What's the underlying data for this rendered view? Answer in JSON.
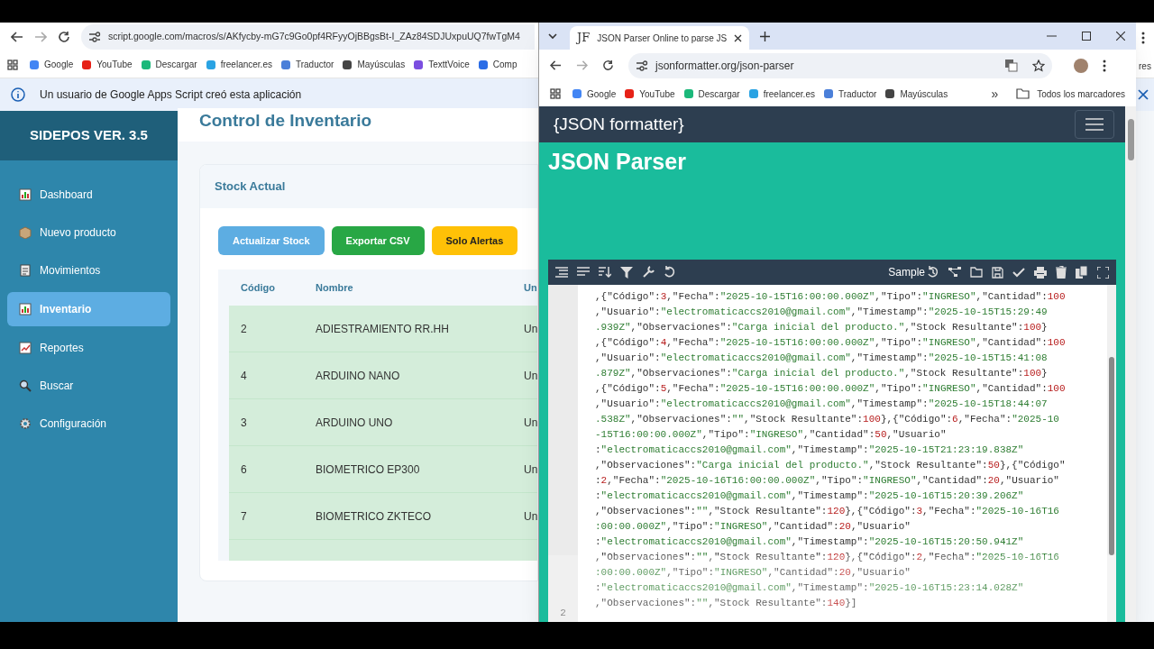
{
  "left_browser": {
    "url": "script.google.com/macros/s/AKfycby-mG7c9Go0pf4RFyyOjBBgsBt-I_ZAz84SDJUxpuUQ7fwTgM4",
    "bookmarks": [
      "Google",
      "YouTube",
      "Descargar",
      "freelancer.es",
      "Traductor",
      "Mayúsculas",
      "TexttVoice",
      "Comp"
    ],
    "bookmarks_tail": "res",
    "info_bar": "Un usuario de Google Apps Script creó esta aplicación"
  },
  "app": {
    "brand": "SIDEPOS VER. 3.5",
    "sidebar": [
      {
        "label": "Dashboard",
        "selected": false
      },
      {
        "label": "Nuevo producto",
        "selected": false
      },
      {
        "label": "Movimientos",
        "selected": false
      },
      {
        "label": "Inventario",
        "selected": true
      },
      {
        "label": "Reportes",
        "selected": false
      },
      {
        "label": "Buscar",
        "selected": false
      },
      {
        "label": "Configuración",
        "selected": false
      }
    ],
    "page_title": "Control de Inventario",
    "card_title": "Stock Actual",
    "buttons": [
      {
        "label": "Actualizar Stock",
        "kind": "info"
      },
      {
        "label": "Exportar CSV",
        "kind": "success"
      },
      {
        "label": "Solo Alertas",
        "kind": "warning"
      }
    ],
    "table": {
      "columns": [
        "Código",
        "Nombre",
        "Un"
      ],
      "rows": [
        [
          "2",
          "ADIESTRAMIENTO RR.HH",
          "Un"
        ],
        [
          "4",
          "ARDUINO NANO",
          "Un"
        ],
        [
          "3",
          "ARDUINO UNO",
          "Un"
        ],
        [
          "6",
          "BIOMETRICO EP300",
          "Un"
        ],
        [
          "7",
          "BIOMETRICO ZKTECO",
          "Un"
        ]
      ]
    }
  },
  "right_browser": {
    "tab_favicon": "JF",
    "tab_title": "JSON Parser Online to parse JS",
    "url": "jsonformatter.org/json-parser",
    "bookmarks": [
      "Google",
      "YouTube",
      "Descargar",
      "freelancer.es",
      "Traductor",
      "Mayúsculas"
    ],
    "more": "»",
    "all_bookmarks": "Todos los marcadores",
    "site_logo": "{JSON formatter}",
    "heading": "JSON Parser",
    "sample_label": "Sample",
    "editor_lines": [
      ",{\"Código\":3,\"Fecha\":\"2025-10-15T16:00:00.000Z\",\"Tipo\":\"INGRESO\",\"Cantidad\":100",
      ",\"Usuario\":\"electromaticaccs2010@gmail.com\",\"Timestamp\":\"2025-10-15T15:29:49",
      ".939Z\",\"Observaciones\":\"Carga inicial del producto.\",\"Stock Resultante\":100}",
      ",{\"Código\":4,\"Fecha\":\"2025-10-15T16:00:00.000Z\",\"Tipo\":\"INGRESO\",\"Cantidad\":100",
      ",\"Usuario\":\"electromaticaccs2010@gmail.com\",\"Timestamp\":\"2025-10-15T15:41:08",
      ".879Z\",\"Observaciones\":\"Carga inicial del producto.\",\"Stock Resultante\":100}",
      ",{\"Código\":5,\"Fecha\":\"2025-10-15T16:00:00.000Z\",\"Tipo\":\"INGRESO\",\"Cantidad\":100",
      ",\"Usuario\":\"electromaticaccs2010@gmail.com\",\"Timestamp\":\"2025-10-15T18:44:07",
      ".538Z\",\"Observaciones\":\"\",\"Stock Resultante\":100},{\"Código\":6,\"Fecha\":\"2025-10",
      "-15T16:00:00.000Z\",\"Tipo\":\"INGRESO\",\"Cantidad\":50,\"Usuario\"",
      ":\"electromaticaccs2010@gmail.com\",\"Timestamp\":\"2025-10-15T21:23:19.838Z\"",
      ",\"Observaciones\":\"Carga inicial del producto.\",\"Stock Resultante\":50},{\"Código\"",
      ":2,\"Fecha\":\"2025-10-16T16:00:00.000Z\",\"Tipo\":\"INGRESO\",\"Cantidad\":20,\"Usuario\"",
      ":\"electromaticaccs2010@gmail.com\",\"Timestamp\":\"2025-10-16T15:20:39.206Z\"",
      ",\"Observaciones\":\"\",\"Stock Resultante\":120},{\"Código\":3,\"Fecha\":\"2025-10-16T16",
      ":00:00.000Z\",\"Tipo\":\"INGRESO\",\"Cantidad\":20,\"Usuario\"",
      ":\"electromaticaccs2010@gmail.com\",\"Timestamp\":\"2025-10-16T15:20:50.941Z\"",
      ",\"Observaciones\":\"\",\"Stock Resultante\":120},{\"Código\":2,\"Fecha\":\"2025-10-16T16",
      ":00:00.000Z\",\"Tipo\":\"INGRESO\",\"Cantidad\":20,\"Usuario\"",
      ":\"electromaticaccs2010@gmail.com\",\"Timestamp\":\"2025-10-16T15:23:14.028Z\"",
      ",\"Observaciones\":\"\",\"Stock Resultante\":140}]"
    ],
    "gutter_number": "2"
  }
}
